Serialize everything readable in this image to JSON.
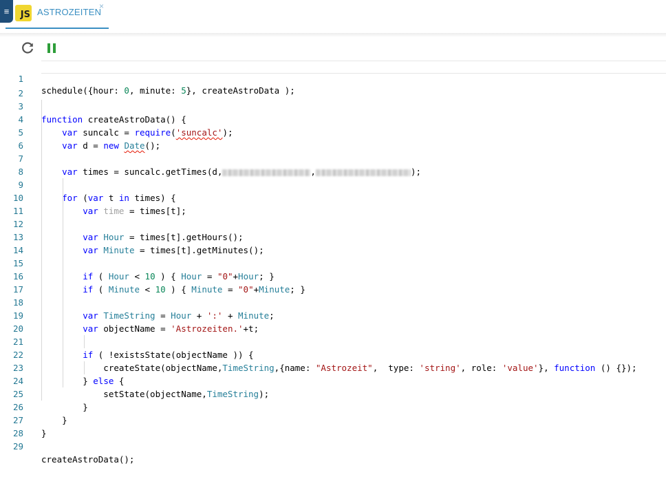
{
  "tab": {
    "title": "ASTROZEITEN",
    "icon_text": "JS",
    "close_glyph": "×"
  },
  "menu": {
    "glyph": "≡"
  },
  "toolbar": {
    "reload_icon": "refresh-icon",
    "pause_icon": "pause-icon"
  },
  "colors": {
    "keyword": "#0000ff",
    "number": "#098658",
    "string": "#a31515",
    "variable": "#267f99",
    "line_number": "#237893",
    "accent": "#3a8fc2"
  },
  "lines": [
    {
      "n": "1",
      "text": "schedule({hour: 0, minute: 5}, createAstroData );"
    },
    {
      "n": "2",
      "text": ""
    },
    {
      "n": "3",
      "text": "function createAstroData() {"
    },
    {
      "n": "4",
      "text": "    var suncalc = require('suncalc');"
    },
    {
      "n": "5",
      "text": "    var d = new Date();"
    },
    {
      "n": "6",
      "text": ""
    },
    {
      "n": "7",
      "text": "    var times = suncalc.getTimes(d,[redacted]);"
    },
    {
      "n": "8",
      "text": ""
    },
    {
      "n": "9",
      "text": "    for (var t in times) {"
    },
    {
      "n": "10",
      "text": "        var time = times[t];"
    },
    {
      "n": "11",
      "text": ""
    },
    {
      "n": "12",
      "text": "        var Hour = times[t].getHours();"
    },
    {
      "n": "13",
      "text": "        var Minute = times[t].getMinutes();"
    },
    {
      "n": "14",
      "text": ""
    },
    {
      "n": "15",
      "text": "        if ( Hour < 10 ) { Hour = \"0\"+Hour; }"
    },
    {
      "n": "16",
      "text": "        if ( Minute < 10 ) { Minute = \"0\"+Minute; }"
    },
    {
      "n": "17",
      "text": ""
    },
    {
      "n": "18",
      "text": "        var TimeString = Hour + ':' + Minute;"
    },
    {
      "n": "19",
      "text": "        var objectName = 'Astrozeiten.'+t;"
    },
    {
      "n": "20",
      "text": ""
    },
    {
      "n": "21",
      "text": "        if ( !existsState(objectName )) {"
    },
    {
      "n": "22",
      "text": "            createState(objectName,TimeString,{name: \"Astrozeit\",  type: 'string', role: 'value'}, function () {});"
    },
    {
      "n": "23",
      "text": "        } else {"
    },
    {
      "n": "24",
      "text": "            setState(objectName,TimeString);"
    },
    {
      "n": "25",
      "text": "        }"
    },
    {
      "n": "26",
      "text": "    }"
    },
    {
      "n": "27",
      "text": "}"
    },
    {
      "n": "28",
      "text": ""
    },
    {
      "n": "29",
      "text": "createAstroData();"
    }
  ]
}
